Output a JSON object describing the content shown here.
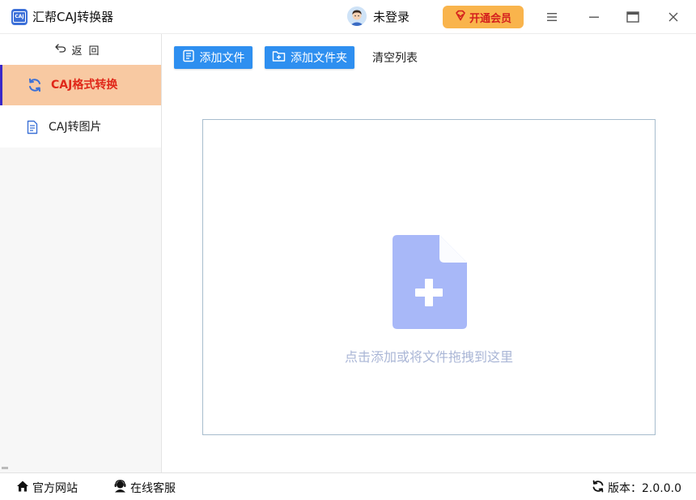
{
  "titlebar": {
    "logo_text": "CAJ",
    "app_title": "汇帮CAJ转换器",
    "login_text": "未登录",
    "vip_label": "开通会员"
  },
  "sidebar": {
    "back_label": "返回",
    "items": [
      {
        "label": "CAJ格式转换",
        "icon": "refresh-icon",
        "active": true
      },
      {
        "label": "CAJ转图片",
        "icon": "document-icon",
        "active": false
      }
    ]
  },
  "toolbar": {
    "add_file_label": "添加文件",
    "add_folder_label": "添加文件夹",
    "clear_label": "清空列表"
  },
  "dropzone": {
    "hint": "点击添加或将文件拖拽到这里"
  },
  "footer": {
    "website_label": "官方网站",
    "support_label": "在线客服",
    "version_label": "版本：2.0.0.0"
  },
  "colors": {
    "accent_blue": "#2e8ff0",
    "active_bg": "#f8c9a2",
    "active_text": "#e0281a",
    "vip_bg": "#f9b44c",
    "dropzone_icon": "#a8b8f8"
  }
}
